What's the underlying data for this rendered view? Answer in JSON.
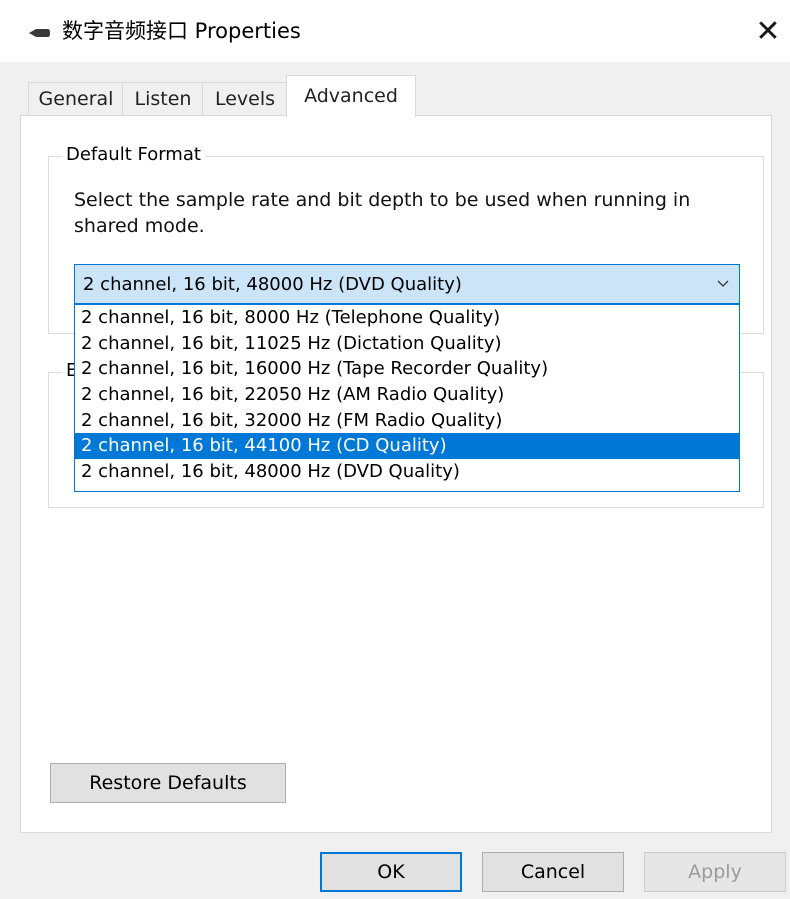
{
  "window": {
    "title": "数字音频接口 Properties",
    "icon": "speaker-icon",
    "close_glyph": "✕"
  },
  "tabs": [
    {
      "label": "General",
      "active": false
    },
    {
      "label": "Listen",
      "active": false
    },
    {
      "label": "Levels",
      "active": false
    },
    {
      "label": "Advanced",
      "active": true
    }
  ],
  "default_format": {
    "legend": "Default Format",
    "description": "Select the sample rate and bit depth to be used when running in shared mode.",
    "selected_value": "2 channel, 16 bit, 48000 Hz (DVD Quality)",
    "options": [
      "2 channel, 16 bit, 8000 Hz (Telephone Quality)",
      "2 channel, 16 bit, 11025 Hz (Dictation Quality)",
      "2 channel, 16 bit, 16000 Hz (Tape Recorder Quality)",
      "2 channel, 16 bit, 22050 Hz (AM Radio Quality)",
      "2 channel, 16 bit, 32000 Hz (FM Radio Quality)",
      "2 channel, 16 bit, 44100 Hz (CD Quality)",
      "2 channel, 16 bit, 48000 Hz (DVD Quality)"
    ],
    "highlighted_index": 5
  },
  "exclusive_group": {
    "legend": "E"
  },
  "buttons": {
    "restore": "Restore Defaults",
    "ok": "OK",
    "cancel": "Cancel",
    "apply": "Apply"
  },
  "colors": {
    "accent": "#0078d7",
    "combo_bg": "#cce4f7",
    "dialog_bg": "#f0f0f0"
  }
}
